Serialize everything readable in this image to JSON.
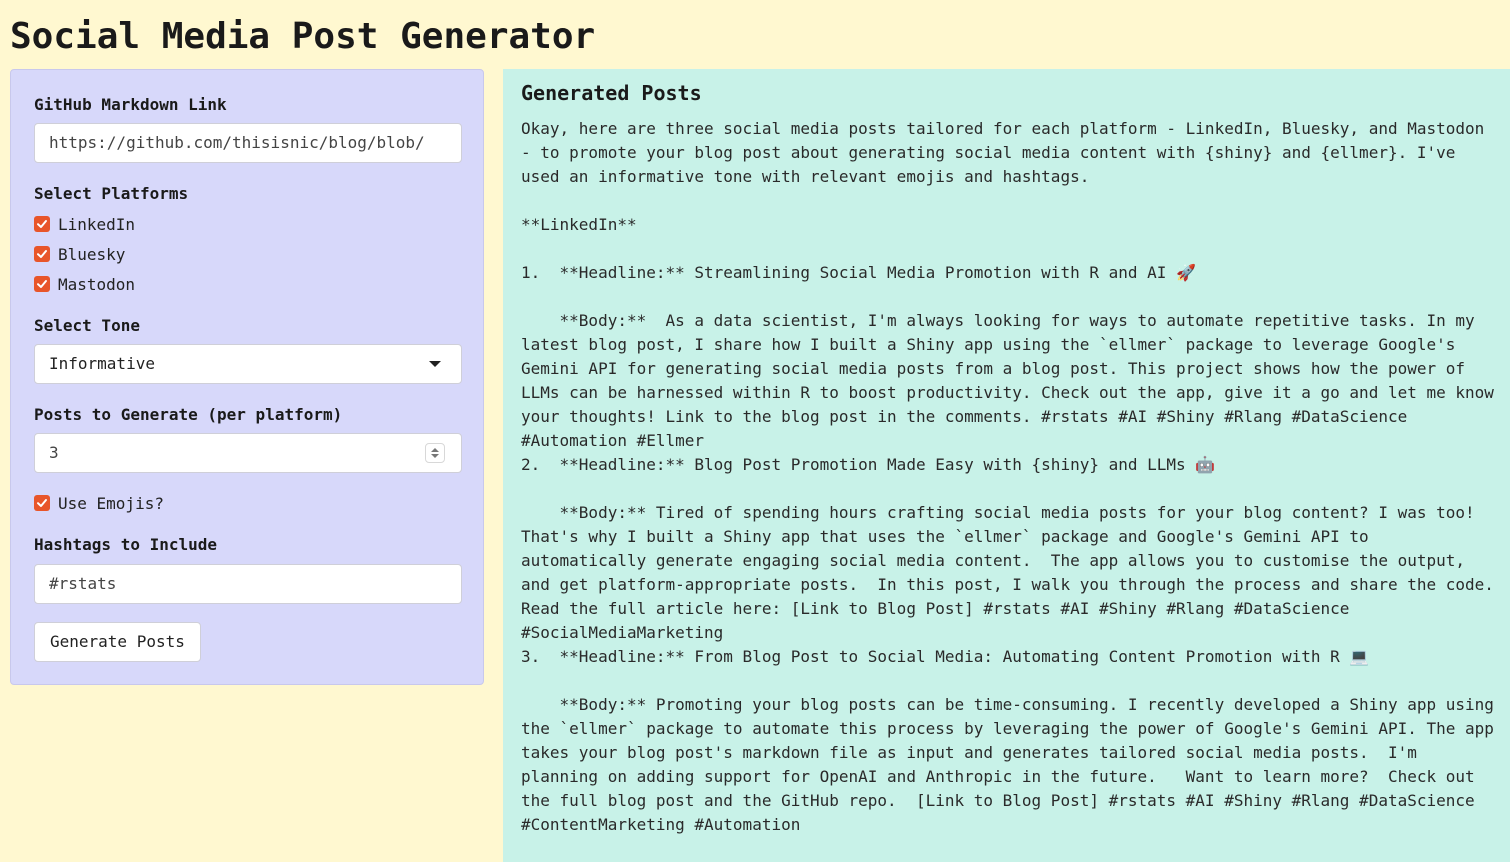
{
  "app": {
    "title": "Social Media Post Generator"
  },
  "sidebar": {
    "markdown_link": {
      "label": "GitHub Markdown Link",
      "value": "https://github.com/thisisnic/blog/blob/"
    },
    "platforms": {
      "label": "Select Platforms",
      "options": [
        {
          "label": "LinkedIn",
          "checked": true
        },
        {
          "label": "Bluesky",
          "checked": true
        },
        {
          "label": "Mastodon",
          "checked": true
        }
      ]
    },
    "tone": {
      "label": "Select Tone",
      "selected": "Informative"
    },
    "posts_count": {
      "label": "Posts to Generate (per platform)",
      "value": "3"
    },
    "emojis": {
      "label": "Use Emojis?",
      "checked": true
    },
    "hashtags": {
      "label": "Hashtags to Include",
      "value": "#rstats"
    },
    "generate_button": "Generate Posts"
  },
  "output": {
    "title": "Generated Posts",
    "text": "Okay, here are three social media posts tailored for each platform - LinkedIn, Bluesky, and Mastodon - to promote your blog post about generating social media content with {shiny} and {ellmer}. I've used an informative tone with relevant emojis and hashtags.\n\n**LinkedIn**\n\n1.  **Headline:** Streamlining Social Media Promotion with R and AI 🚀\n\n    **Body:**  As a data scientist, I'm always looking for ways to automate repetitive tasks. In my latest blog post, I share how I built a Shiny app using the `ellmer` package to leverage Google's Gemini API for generating social media posts from a blog post. This project shows how the power of LLMs can be harnessed within R to boost productivity. Check out the app, give it a go and let me know your thoughts! Link to the blog post in the comments. #rstats #AI #Shiny #Rlang #DataScience #Automation #Ellmer\n2.  **Headline:** Blog Post Promotion Made Easy with {shiny} and LLMs 🤖\n\n    **Body:** Tired of spending hours crafting social media posts for your blog content? I was too! That's why I built a Shiny app that uses the `ellmer` package and Google's Gemini API to automatically generate engaging social media content.  The app allows you to customise the output, and get platform-appropriate posts.  In this post, I walk you through the process and share the code. Read the full article here: [Link to Blog Post] #rstats #AI #Shiny #Rlang #DataScience #SocialMediaMarketing\n3.  **Headline:** From Blog Post to Social Media: Automating Content Promotion with R 💻\n\n    **Body:** Promoting your blog posts can be time-consuming. I recently developed a Shiny app using the `ellmer` package to automate this process by leveraging the power of Google's Gemini API. The app takes your blog post's markdown file as input and generates tailored social media posts.  I'm planning on adding support for OpenAI and Anthropic in the future.   Want to learn more?  Check out the full blog post and the GitHub repo.  [Link to Blog Post] #rstats #AI #Shiny #Rlang #DataScience #ContentMarketing #Automation"
  },
  "colors": {
    "page_bg": "#fff8d0",
    "sidebar_bg": "#d7d8fa",
    "output_bg": "#c8f2e8",
    "checkbox_accent": "#e8552a"
  },
  "icons": {
    "checkbox": "check-icon",
    "select": "caret-down-icon",
    "stepper": "spinner-arrows-icon"
  }
}
